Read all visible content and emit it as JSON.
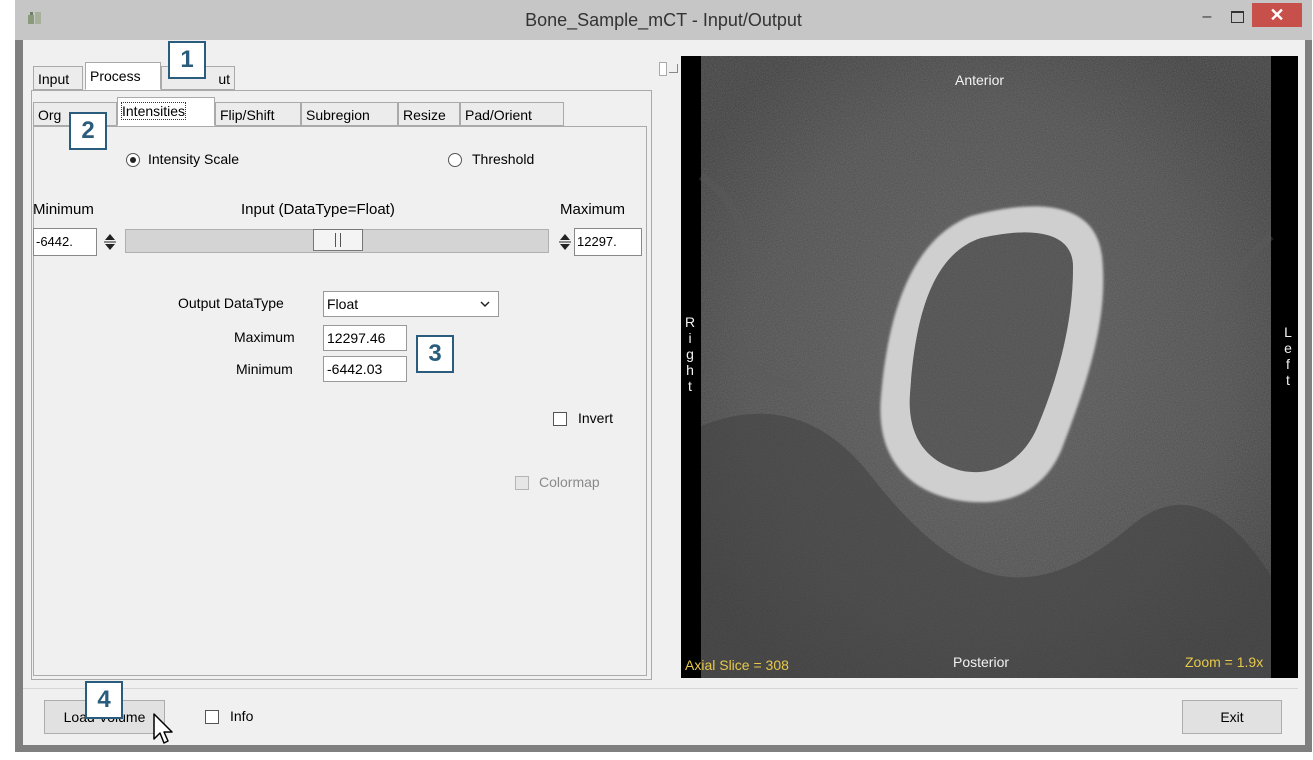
{
  "window": {
    "title": "Bone_Sample_mCT - Input/Output",
    "minimize_glyph": "–",
    "close_glyph": "✕"
  },
  "tabs_main": [
    {
      "label": "Input"
    },
    {
      "label": "Process"
    },
    {
      "label": "Output",
      "visible_fragment": "ut"
    }
  ],
  "tabs_sub": [
    {
      "label": "Org"
    },
    {
      "label": "Intensities"
    },
    {
      "label": "Flip/Shift"
    },
    {
      "label": "Subregion"
    },
    {
      "label": "Resize"
    },
    {
      "label": "Pad/Orient"
    }
  ],
  "mode": {
    "intensity_scale_label": "Intensity Scale",
    "threshold_label": "Threshold",
    "selected": "Intensity Scale"
  },
  "range": {
    "minimum_label": "Minimum",
    "input_label": "Input (DataType=Float)",
    "maximum_label": "Maximum",
    "min_value": "-6442.",
    "max_value": "12297."
  },
  "output": {
    "datatype_label": "Output DataType",
    "datatype_value": "Float",
    "maximum_label": "Maximum",
    "maximum_value": "12297.46",
    "minimum_label": "Minimum",
    "minimum_value": "-6442.03"
  },
  "options": {
    "invert_label": "Invert",
    "invert_checked": false,
    "colormap_label": "Colormap",
    "colormap_checked": false,
    "colormap_enabled": false
  },
  "bottom": {
    "load_volume_label": "Load Volume",
    "info_label": "Info",
    "info_checked": false,
    "exit_label": "Exit"
  },
  "viewer": {
    "anterior": "Anterior",
    "posterior": "Posterior",
    "right_letters": [
      "R",
      "i",
      "g",
      "h",
      "t"
    ],
    "left_letters": [
      "L",
      "e",
      "f",
      "t"
    ],
    "slice_text": "Axial Slice = 308",
    "zoom_text": "Zoom = 1.9x"
  },
  "callouts": [
    "1",
    "2",
    "3",
    "4"
  ],
  "colors": {
    "callout_border": "#2a5d7d",
    "close_button": "#c7504b",
    "overlay_yellow": "#e6c84a"
  }
}
